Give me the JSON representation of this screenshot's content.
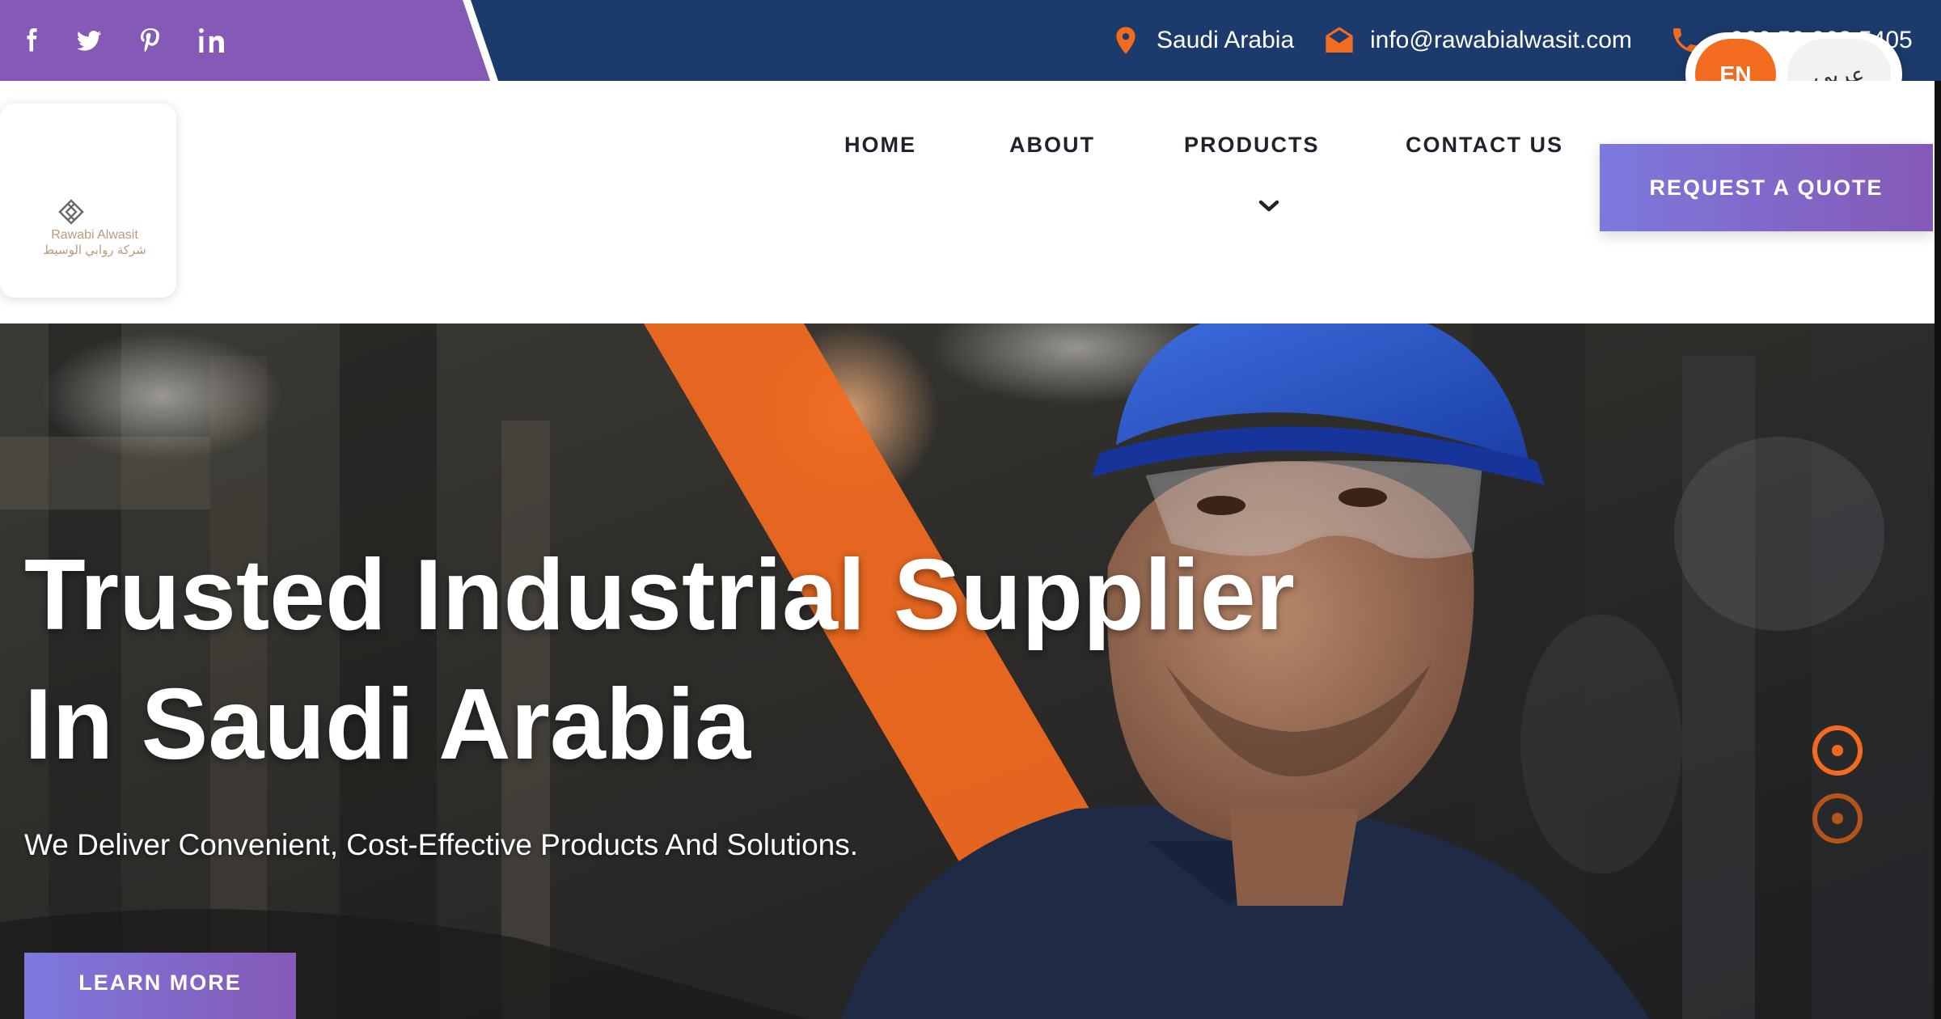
{
  "topbar": {
    "social_icons": [
      "facebook-icon",
      "twitter-icon",
      "pinterest-icon",
      "linkedin-icon"
    ],
    "location": "Saudi Arabia",
    "email": "info@rawabialwasit.com",
    "phone": "+966 50 063 5405",
    "colors": {
      "social_panel": "#8559b6",
      "bar": "#1c3a6b",
      "icon_accent": "#f26b1f"
    }
  },
  "language": {
    "active": "EN",
    "alternate": "عربي"
  },
  "logo": {
    "name_en": "Rawabi Alwasit",
    "name_ar": "شركة روابي الوسيط"
  },
  "nav": {
    "items": [
      "HOME",
      "ABOUT",
      "PRODUCTS",
      "CONTACT US"
    ],
    "products_dropdown_icon": "chevron-down-icon",
    "cta": "REQUEST A QUOTE"
  },
  "hero": {
    "title_line1": "Trusted Industrial Supplier",
    "title_line2": "In Saudi Arabia",
    "subtitle": "We Deliver Convenient, Cost-Effective Products And Solutions.",
    "button": "LEARN MORE",
    "slides_total": 2,
    "active_slide": 1,
    "colors": {
      "accent_stripe": "#f26b1f",
      "button_gradient": [
        "#7d79dd",
        "#8559b6"
      ]
    }
  }
}
